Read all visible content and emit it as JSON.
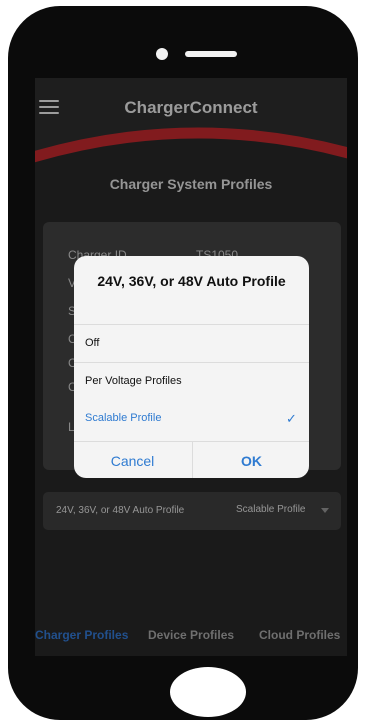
{
  "app": {
    "title": "ChargerConnect",
    "accent_color": "#b3262a",
    "menu_icon": "hamburger-icon"
  },
  "page": {
    "title": "Charger System Profiles"
  },
  "info_card": {
    "rows": [
      {
        "label": "Charger ID",
        "value": "TS1050"
      },
      {
        "label": "V",
        "value": ""
      },
      {
        "label": "S",
        "value": ""
      },
      {
        "label": "C",
        "value": ""
      },
      {
        "label": "C",
        "value": ""
      },
      {
        "label": "C",
        "value": ""
      },
      {
        "label": "L",
        "value": ""
      }
    ]
  },
  "setting": {
    "label": "24V, 36V, or 48V Auto Profile",
    "value": "Scalable Profile"
  },
  "dialog": {
    "title": "24V, 36V, or 48V Auto Profile",
    "options": [
      {
        "label": "Off"
      },
      {
        "label": "Per Voltage Profiles"
      },
      {
        "label": "Scalable Profile"
      }
    ],
    "selected": "Scalable Profile",
    "check_icon": "checkmark-icon",
    "cancel_label": "Cancel",
    "ok_label": "OK"
  },
  "tabs": [
    {
      "label": "Charger Profiles",
      "active": true
    },
    {
      "label": "Device Profiles",
      "active": false
    },
    {
      "label": "Cloud Profiles",
      "active": false
    }
  ]
}
